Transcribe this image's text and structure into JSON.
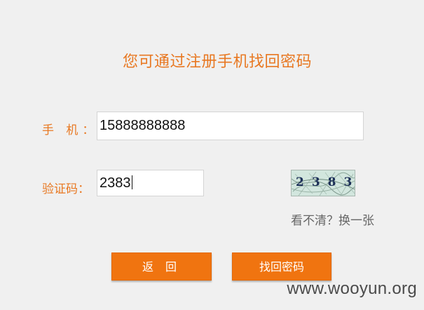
{
  "form": {
    "title": "您可通过注册手机找回密码",
    "phone_label": "手 机：",
    "phone_value": "15888888888",
    "code_label": "验证码：",
    "code_value": "2383",
    "captcha_text": "2383",
    "refresh_link": "看不清？换一张"
  },
  "buttons": {
    "back_label": "返 回",
    "find_label": "找回密码"
  },
  "watermark": "www.wooyun.org",
  "colors": {
    "accent": "#e87822",
    "button": "#f07410",
    "captcha_bg": "#d2e6de"
  }
}
